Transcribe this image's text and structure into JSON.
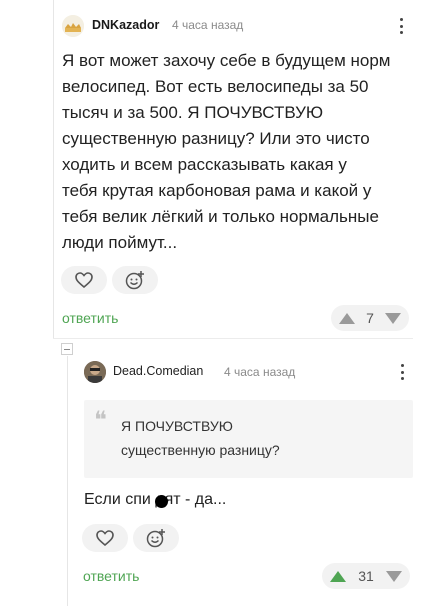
{
  "comment": {
    "author": "DNKazador",
    "time": "4 часа назад",
    "text": "Я вот может захочу себе в будущем норм\nвелосипед. Вот есть велосипеды за 50\nтысяч и за 500. Я ПОЧУВСТВУЮ\nсущественную разницу? Или это чисто\nходить и всем рассказывать какая у\nтебя крутая карбоновая рама и какой у\nтебя велик лёгкий и только нормальные\nлюди поймут...",
    "reply_label": "ответить",
    "rating": "7"
  },
  "reply": {
    "author": "Dead.Comedian",
    "time": "4 часа назад",
    "quote": "Я ПОЧУВСТВУЮ\nсущественную разницу?",
    "quote_mark": "❝",
    "text": "Если спи   дят - да...",
    "reply_label": "ответить",
    "rating": "31"
  },
  "colors": {
    "accent": "#4fa553",
    "muted": "#8a8a8a",
    "pill_bg": "#f2f2f2"
  },
  "icons": {
    "like": "heart-icon",
    "reaction": "add-emoji-icon",
    "upvote": "arrow-up-icon",
    "downvote": "arrow-down-icon",
    "menu": "more-vertical-icon",
    "collapse": "collapse-minus-icon",
    "quote": "quote-icon"
  }
}
